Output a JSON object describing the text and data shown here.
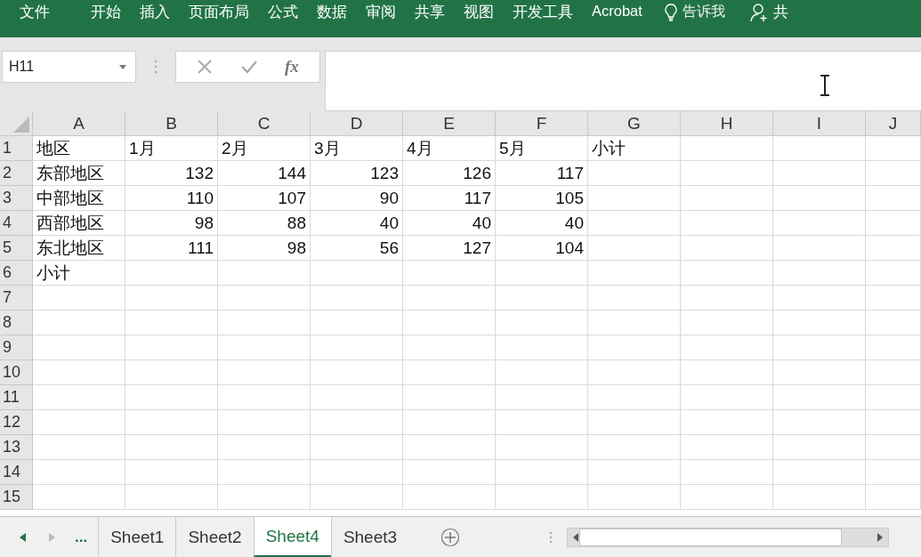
{
  "ribbon": {
    "tabs": [
      "文件",
      "开始",
      "插入",
      "页面布局",
      "公式",
      "数据",
      "审阅",
      "共享",
      "视图",
      "开发工具",
      "Acrobat"
    ],
    "tell_me": "告诉我",
    "share": "共"
  },
  "formula_bar": {
    "name_box": "H11",
    "fx": "fx"
  },
  "sheet": {
    "columns": [
      "A",
      "B",
      "C",
      "D",
      "E",
      "F",
      "G",
      "H",
      "I",
      "J"
    ],
    "rows": [
      {
        "header": "1",
        "cells": [
          "地区",
          "1月",
          "2月",
          "3月",
          "4月",
          "5月",
          "小计",
          "",
          "",
          ""
        ]
      },
      {
        "header": "2",
        "cells": [
          "东部地区",
          "132",
          "144",
          "123",
          "126",
          "117",
          "",
          "",
          "",
          ""
        ]
      },
      {
        "header": "3",
        "cells": [
          "中部地区",
          "110",
          "107",
          "90",
          "117",
          "105",
          "",
          "",
          "",
          ""
        ]
      },
      {
        "header": "4",
        "cells": [
          "西部地区",
          "98",
          "88",
          "40",
          "40",
          "40",
          "",
          "",
          "",
          ""
        ]
      },
      {
        "header": "5",
        "cells": [
          "东北地区",
          "111",
          "98",
          "56",
          "127",
          "104",
          "",
          "",
          "",
          ""
        ]
      },
      {
        "header": "6",
        "cells": [
          "小计",
          "",
          "",
          "",
          "",
          "",
          "",
          "",
          "",
          ""
        ]
      },
      {
        "header": "7",
        "cells": []
      },
      {
        "header": "8",
        "cells": []
      },
      {
        "header": "9",
        "cells": []
      },
      {
        "header": "10",
        "cells": []
      },
      {
        "header": "11",
        "cells": []
      },
      {
        "header": "12",
        "cells": []
      },
      {
        "header": "13",
        "cells": []
      },
      {
        "header": "14",
        "cells": []
      },
      {
        "header": "15",
        "cells": []
      }
    ]
  },
  "sheet_tabs": {
    "more": "...",
    "tabs": [
      {
        "label": "Sheet1",
        "selected": false
      },
      {
        "label": "Sheet2",
        "selected": false
      },
      {
        "label": "Sheet4",
        "selected": true
      },
      {
        "label": "Sheet3",
        "selected": false
      }
    ]
  }
}
